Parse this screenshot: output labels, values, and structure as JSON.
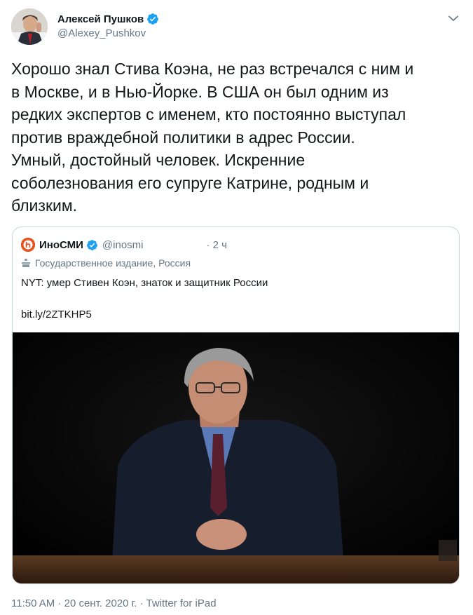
{
  "author": {
    "display_name": "Алексей Пушков",
    "handle": "@Alexey_Pushkov"
  },
  "tweet": {
    "text": "Хорошо знал Стива Коэна, не раз встречался с ним и\nв Москве, и в Нью-Йорке. В США он был одним из\nредких экспертов с именем, кто постоянно выступал\nпротив враждебной политики в адрес России.\nУмный, достойный человек. Искренние\nсоболезнования его супруге Катрине, родным и\nблизким."
  },
  "quoted": {
    "display_name": "ИноСМИ",
    "handle": "@inosmi",
    "time": "· 2 ч",
    "label": "Государственное издание, Россия",
    "text": "NYT: умер Стивен Коэн, знаток и защитник России",
    "link": "bit.ly/2ZTKHP5"
  },
  "footer": {
    "time": "11:50 AM",
    "date": "20 сент. 2020 г.",
    "source": "Twitter for iPad"
  },
  "colors": {
    "verified": "#1da1f2",
    "muted": "#657786",
    "border": "#ccd6dd",
    "inosmi_logo": "#e8501c"
  },
  "icons": [
    "verified-badge-icon",
    "chevron-down-icon",
    "state-media-podium-icon"
  ]
}
